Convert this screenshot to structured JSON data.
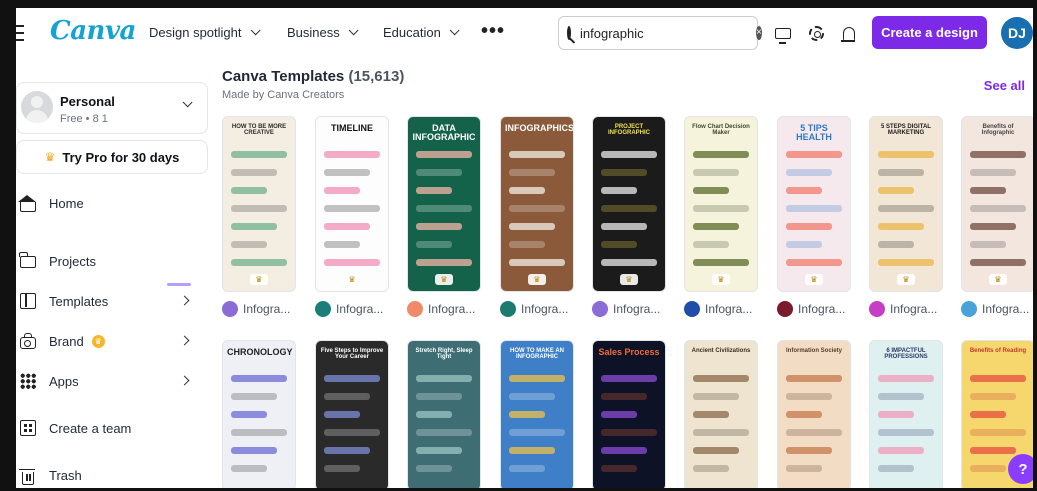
{
  "header": {
    "logo": "Canva",
    "nav": [
      "Design spotlight",
      "Business",
      "Education"
    ],
    "more": "•••",
    "search_value": "infographic",
    "clear": "×",
    "create_label": "Create a design",
    "avatar_initials": "DJ"
  },
  "sidebar": {
    "account_name": "Personal",
    "account_sub": "Free • 8 1",
    "pro_label": "Try Pro for 30 days",
    "crown": "♛",
    "items": [
      {
        "label": "Home",
        "icon": "home-icon"
      },
      {
        "label": "Projects",
        "icon": "folder-icon"
      },
      {
        "label": "Templates",
        "icon": "templates-icon"
      },
      {
        "label": "Brand",
        "icon": "brand-icon"
      },
      {
        "label": "Apps",
        "icon": "apps-icon"
      },
      {
        "label": "Create a team",
        "icon": "team-icon"
      },
      {
        "label": "Trash",
        "icon": "trash-icon"
      }
    ]
  },
  "main": {
    "title": "Canva Templates",
    "count": "(15,613)",
    "subtitle": "Made by Canva Creators",
    "see_all": "See all",
    "author_label": "Infogra...",
    "row1": [
      {
        "title": "HOW TO BE MORE CREATIVE",
        "bg": "#f4ede2",
        "fg": "#2b2b2b",
        "accent": "#6fb08a",
        "author_color": "#8b6bd6"
      },
      {
        "title": "TIMELINE",
        "bg": "#fdfdfd",
        "fg": "#111111",
        "accent": "#f08fb5",
        "author_color": "#1b7e7a"
      },
      {
        "title": "DATA INFOGRAPHIC",
        "bg": "#15624a",
        "fg": "#ffffff",
        "accent": "#f4b6a8",
        "author_color": "#f08a6a"
      },
      {
        "title": "INFOGRAPHICS",
        "bg": "#8a5a3a",
        "fg": "#ffffff",
        "accent": "#f3efe6",
        "author_color": "#1d7a70"
      },
      {
        "title": "PROJECT INFOGRAPHIC",
        "bg": "#1b1b1b",
        "fg": "#f2e14a",
        "accent": "#ececec",
        "author_color": "#8b6bd6"
      },
      {
        "title": "Flow Chart Decision Maker",
        "bg": "#f6f3dc",
        "fg": "#3d4a2a",
        "accent": "#5a6b2a",
        "author_color": "#1f4ea8"
      },
      {
        "title": "5 TIPS HEALTH",
        "bg": "#f6e9ee",
        "fg": "#2f79c7",
        "accent": "#f27a6a",
        "author_color": "#7a1a2a"
      },
      {
        "title": "5 STEPS DIGITAL MARKETING",
        "bg": "#f2e7d6",
        "fg": "#1b1b1b",
        "accent": "#e9b64a",
        "author_color": "#c63dc6"
      },
      {
        "title": "Benefits of Infographic",
        "bg": "#f3e6df",
        "fg": "#444444",
        "accent": "#6d4a3e",
        "author_color": "#4aa3d8"
      }
    ],
    "row2": [
      {
        "title": "CHRONOLOGY",
        "bg": "#eef0f6",
        "fg": "#222222",
        "accent": "#6b6bd6"
      },
      {
        "title": "Five Steps to Improve Your Career",
        "bg": "#2a2a2a",
        "fg": "#ffffff",
        "accent": "#7f8fd6"
      },
      {
        "title": "Stretch Right, Sleep Tight",
        "bg": "#3e6e74",
        "fg": "#ffffff",
        "accent": "#9ec4c2"
      },
      {
        "title": "HOW TO MAKE AN INFOGRAPHIC",
        "bg": "#3f7fc7",
        "fg": "#ffffff",
        "accent": "#f2c14a"
      },
      {
        "title": "Sales Process",
        "bg": "#0d1226",
        "fg": "#f26a3a",
        "accent": "#8b4cd6"
      },
      {
        "title": "Ancient Civilizations",
        "bg": "#efe4d0",
        "fg": "#3b2e1e",
        "accent": "#8a6a4a"
      },
      {
        "title": "Information Society",
        "bg": "#f3dcc4",
        "fg": "#5a3a2a",
        "accent": "#c47a4a"
      },
      {
        "title": "6 IMPACTFUL PROFESSIONS",
        "bg": "#dff0f0",
        "fg": "#2a3a6a",
        "accent": "#f29ab8"
      },
      {
        "title": "Benefits of Reading",
        "bg": "#f6d76e",
        "fg": "#c0392b",
        "accent": "#e74c3c"
      }
    ]
  },
  "help_label": "?"
}
